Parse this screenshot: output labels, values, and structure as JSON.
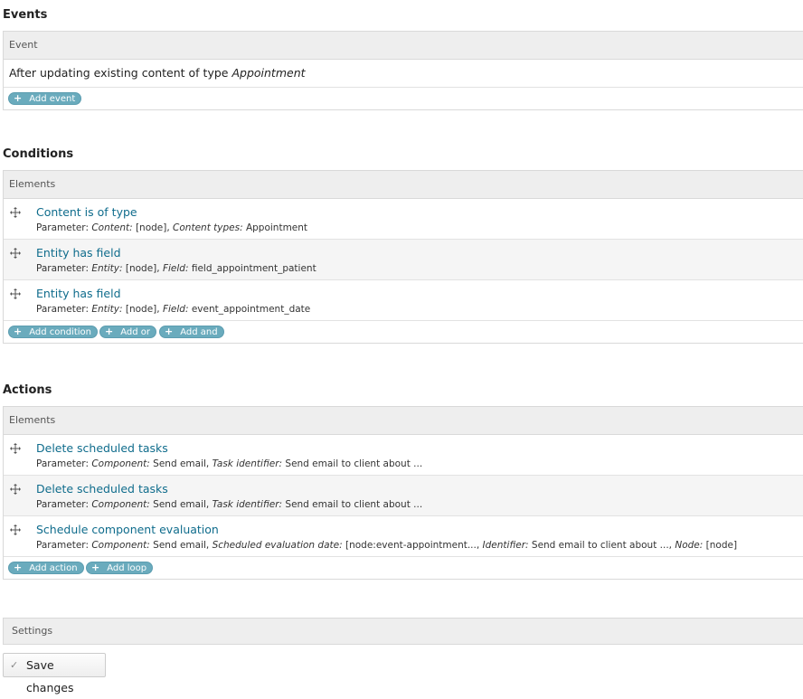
{
  "events": {
    "title": "Events",
    "header": "Event",
    "row_text": "After updating existing content of type",
    "row_type": "Appointment",
    "buttons": [
      "Add event"
    ]
  },
  "conditions": {
    "title": "Conditions",
    "header": "Elements",
    "items": [
      {
        "label": "Content is of type",
        "param_prefix": "Parameter:",
        "params": [
          {
            "k": "Content:",
            "v": " [node], "
          },
          {
            "k": "Content types:",
            "v": " Appointment"
          }
        ]
      },
      {
        "label": "Entity has field",
        "param_prefix": "Parameter:",
        "params": [
          {
            "k": "Entity:",
            "v": " [node], "
          },
          {
            "k": "Field:",
            "v": " field_appointment_patient"
          }
        ]
      },
      {
        "label": "Entity has field",
        "param_prefix": "Parameter:",
        "params": [
          {
            "k": "Entity:",
            "v": " [node], "
          },
          {
            "k": "Field:",
            "v": " event_appointment_date"
          }
        ]
      }
    ],
    "buttons": [
      "Add condition",
      "Add or",
      "Add and"
    ]
  },
  "actions": {
    "title": "Actions",
    "header": "Elements",
    "items": [
      {
        "label": "Delete scheduled tasks",
        "param_prefix": "Parameter:",
        "params": [
          {
            "k": "Component:",
            "v": " Send email, "
          },
          {
            "k": "Task identifier:",
            "v": " Send email to client about ..."
          }
        ]
      },
      {
        "label": "Delete scheduled tasks",
        "param_prefix": "Parameter:",
        "params": [
          {
            "k": "Component:",
            "v": " Send email, "
          },
          {
            "k": "Task identifier:",
            "v": " Send email to client about ..."
          }
        ]
      },
      {
        "label": "Schedule component evaluation",
        "param_prefix": "Parameter:",
        "params": [
          {
            "k": "Component:",
            "v": " Send email, "
          },
          {
            "k": "Scheduled evaluation date:",
            "v": " [node:event-appointment..., "
          },
          {
            "k": "Identifier:",
            "v": " Send email to client about ..., "
          },
          {
            "k": "Node:",
            "v": " [node]"
          }
        ]
      }
    ],
    "buttons": [
      "Add action",
      "Add loop"
    ]
  },
  "settings": {
    "label": "Settings"
  },
  "save": {
    "label": "Save changes"
  },
  "colors": {
    "link": "#0f6c8c",
    "pill": "#6aabbd",
    "header_bg": "#eeeeee"
  }
}
